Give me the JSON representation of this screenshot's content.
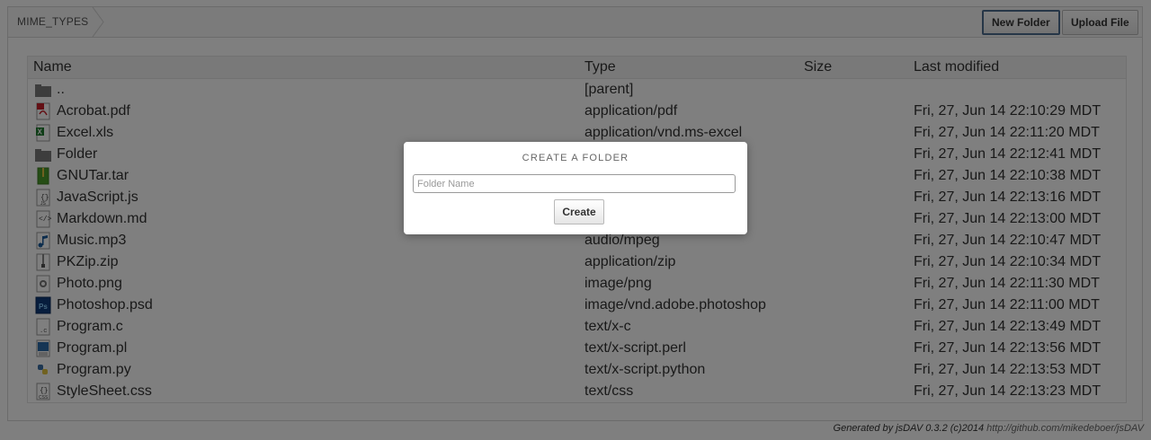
{
  "breadcrumb": {
    "label": "MIME_TYPES"
  },
  "toolbar": {
    "new_folder_label": "New Folder",
    "upload_file_label": "Upload File"
  },
  "table": {
    "columns": [
      "Name",
      "Type",
      "Size",
      "Last modified"
    ],
    "rows": [
      {
        "name": "..",
        "type": "[parent]",
        "size": "",
        "modified": "",
        "icon": "folder-icon"
      },
      {
        "name": "Acrobat.pdf",
        "type": "application/pdf",
        "size": "",
        "modified": "Fri, 27, Jun 14 22:10:29 MDT",
        "icon": "pdf-file-icon"
      },
      {
        "name": "Excel.xls",
        "type": "application/vnd.ms-excel",
        "size": "",
        "modified": "Fri, 27, Jun 14 22:11:20 MDT",
        "icon": "excel-file-icon"
      },
      {
        "name": "Folder",
        "type": "",
        "size": "",
        "modified": "Fri, 27, Jun 14 22:12:41 MDT",
        "icon": "folder-icon"
      },
      {
        "name": "GNUTar.tar",
        "type": "",
        "size": "",
        "modified": "Fri, 27, Jun 14 22:10:38 MDT",
        "icon": "archive-file-icon"
      },
      {
        "name": "JavaScript.js",
        "type": "",
        "size": "",
        "modified": "Fri, 27, Jun 14 22:13:16 MDT",
        "icon": "js-file-icon"
      },
      {
        "name": "Markdown.md",
        "type": "",
        "size": "",
        "modified": "Fri, 27, Jun 14 22:13:00 MDT",
        "icon": "html-file-icon"
      },
      {
        "name": "Music.mp3",
        "type": "audio/mpeg",
        "size": "",
        "modified": "Fri, 27, Jun 14 22:10:47 MDT",
        "icon": "audio-file-icon"
      },
      {
        "name": "PKZip.zip",
        "type": "application/zip",
        "size": "",
        "modified": "Fri, 27, Jun 14 22:10:34 MDT",
        "icon": "zip-file-icon"
      },
      {
        "name": "Photo.png",
        "type": "image/png",
        "size": "",
        "modified": "Fri, 27, Jun 14 22:11:30 MDT",
        "icon": "image-file-icon"
      },
      {
        "name": "Photoshop.psd",
        "type": "image/vnd.adobe.photoshop",
        "size": "",
        "modified": "Fri, 27, Jun 14 22:11:00 MDT",
        "icon": "photoshop-file-icon"
      },
      {
        "name": "Program.c",
        "type": "text/x-c",
        "size": "",
        "modified": "Fri, 27, Jun 14 22:13:49 MDT",
        "icon": "code-file-icon"
      },
      {
        "name": "Program.pl",
        "type": "text/x-script.perl",
        "size": "",
        "modified": "Fri, 27, Jun 14 22:13:56 MDT",
        "icon": "text-file-icon"
      },
      {
        "name": "Program.py",
        "type": "text/x-script.python",
        "size": "",
        "modified": "Fri, 27, Jun 14 22:13:53 MDT",
        "icon": "python-file-icon"
      },
      {
        "name": "StyleSheet.css",
        "type": "text/css",
        "size": "",
        "modified": "Fri, 27, Jun 14 22:13:23 MDT",
        "icon": "css-file-icon"
      }
    ]
  },
  "modal": {
    "title": "CREATE A FOLDER",
    "input_placeholder": "Folder Name",
    "input_value": "",
    "create_label": "Create"
  },
  "footer": {
    "generated_text": "Generated by jsDAV 0.3.2 (c)2014",
    "url": "http://github.com/mikedeboer/jsDAV"
  }
}
